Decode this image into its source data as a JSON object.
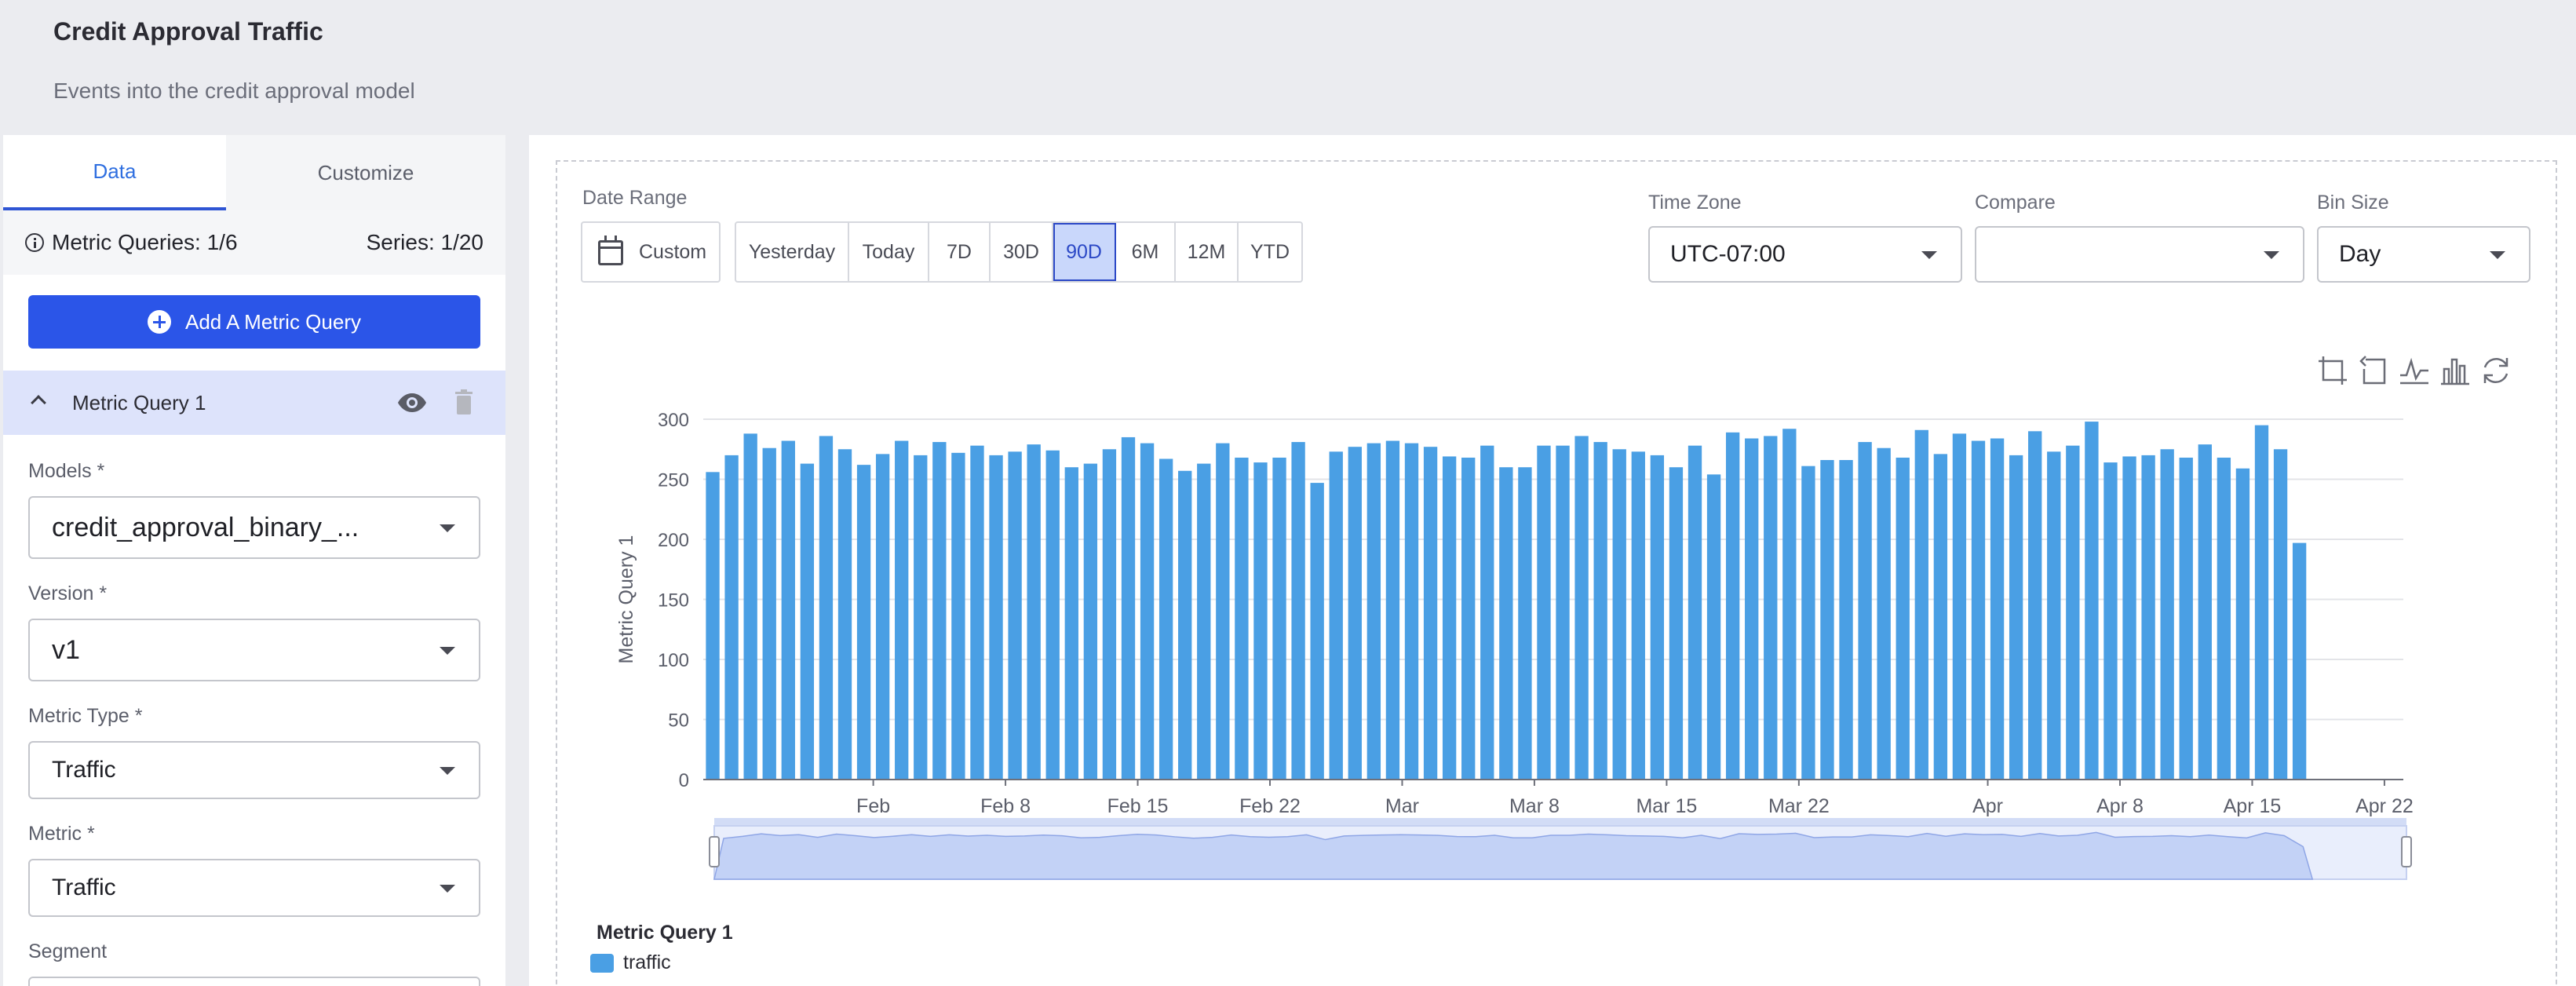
{
  "header": {
    "title": "Credit Approval Traffic",
    "subtitle": "Events into the credit approval model"
  },
  "left_panel": {
    "tabs": [
      {
        "label": "Data",
        "active": true
      },
      {
        "label": "Customize",
        "active": false
      }
    ],
    "metric_queries_label": "Metric Queries: 1/6",
    "series_label": "Series: 1/20",
    "add_button_label": "Add A Metric Query",
    "query": {
      "title": "Metric Query 1",
      "fields": [
        {
          "label": "Models *",
          "value": "credit_approval_binary_..."
        },
        {
          "label": "Version *",
          "value": "v1"
        },
        {
          "label": "Metric Type *",
          "value": "Traffic"
        },
        {
          "label": "Metric *",
          "value": "Traffic"
        },
        {
          "label": "Segment",
          "value": ""
        }
      ]
    }
  },
  "controls": {
    "date_range_label": "Date Range",
    "custom_label": "Custom",
    "ranges": [
      {
        "label": "Yesterday",
        "active": false
      },
      {
        "label": "Today",
        "active": false
      },
      {
        "label": "7D",
        "active": false
      },
      {
        "label": "30D",
        "active": false
      },
      {
        "label": "90D",
        "active": true
      },
      {
        "label": "6M",
        "active": false
      },
      {
        "label": "12M",
        "active": false
      },
      {
        "label": "YTD",
        "active": false
      }
    ],
    "time_zone_label": "Time Zone",
    "time_zone_value": "UTC-07:00",
    "compare_label": "Compare",
    "compare_value": "",
    "bin_size_label": "Bin Size",
    "bin_size_value": "Day"
  },
  "chart_data": {
    "type": "bar",
    "ylabel": "Metric Query 1",
    "xlabel": "",
    "ylim": [
      0,
      300
    ],
    "yticks": [
      0,
      50,
      100,
      150,
      200,
      250,
      300
    ],
    "x_tick_labels": [
      "Feb",
      "Feb 8",
      "Feb 15",
      "Feb 22",
      "Mar",
      "Mar 8",
      "Mar 15",
      "Mar 22",
      "Apr",
      "Apr 8",
      "Apr 15",
      "Apr 22"
    ],
    "x_start": "2023-01-23",
    "x_end": "2023-04-23",
    "grid": true,
    "series": [
      {
        "name": "traffic",
        "color": "#4a9fe4",
        "values": [
          256,
          270,
          288,
          276,
          282,
          263,
          286,
          275,
          262,
          271,
          282,
          270,
          281,
          272,
          278,
          270,
          273,
          279,
          274,
          260,
          263,
          275,
          285,
          280,
          267,
          257,
          263,
          280,
          268,
          264,
          268,
          281,
          247,
          273,
          277,
          280,
          282,
          280,
          277,
          269,
          268,
          278,
          260,
          260,
          278,
          278,
          286,
          281,
          275,
          273,
          270,
          260,
          278,
          254,
          289,
          284,
          286,
          292,
          261,
          266,
          266,
          281,
          276,
          268,
          291,
          271,
          288,
          282,
          284,
          270,
          290,
          273,
          278,
          298,
          264,
          269,
          270,
          275,
          268,
          279,
          268,
          259,
          295,
          275,
          197
        ]
      }
    ],
    "legend_title": "Metric Query 1",
    "legend_placement": "bottom-left"
  }
}
